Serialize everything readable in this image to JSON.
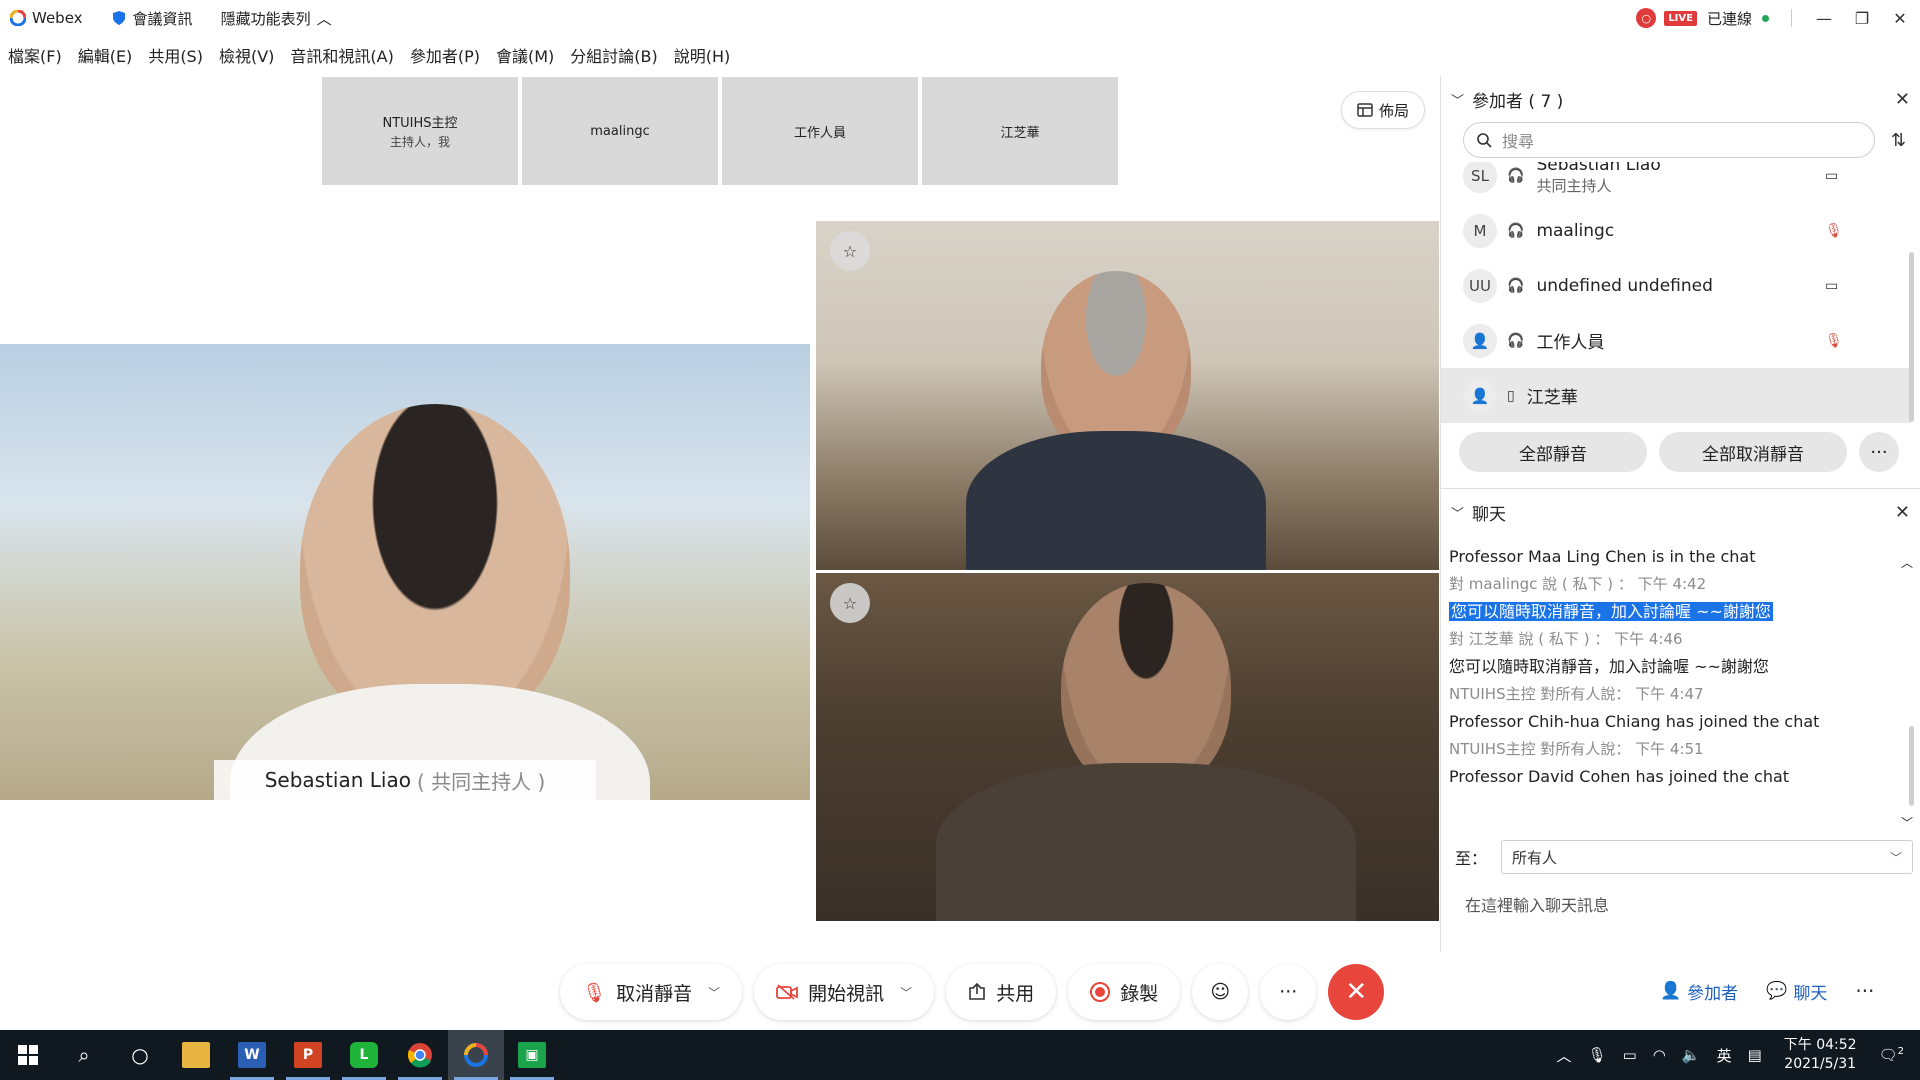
{
  "titlebar": {
    "app_name": "Webex",
    "meeting_info": "會議資訊",
    "hide_menu": "隱藏功能表列",
    "live_badge": "LIVE",
    "connected": "已連線"
  },
  "menu": [
    "檔案(F)",
    "編輯(E)",
    "共用(S)",
    "檢視(V)",
    "音訊和視訊(A)",
    "參加者(P)",
    "會議(M)",
    "分組討論(B)",
    "說明(H)"
  ],
  "menu_keys": [
    "F",
    "E",
    "S",
    "V",
    "A",
    "P",
    "M",
    "B",
    "H"
  ],
  "thumbnails": [
    {
      "name": "NTUIHS主控",
      "sub": "主持人，我"
    },
    {
      "name": "maalingc",
      "sub": ""
    },
    {
      "name": "工作人員",
      "sub": ""
    },
    {
      "name": "江芝華",
      "sub": ""
    }
  ],
  "layout_button": "佈局",
  "main_video": {
    "name": "Sebastian Liao",
    "role": "( 共同主持人 )"
  },
  "controls": {
    "unmute": "取消靜音",
    "start_video": "開始視訊",
    "share": "共用",
    "record": "錄製"
  },
  "bottom_right": {
    "participants": "參加者",
    "chat": "聊天"
  },
  "participants_panel": {
    "title": "參加者 ( 7 )",
    "search_placeholder": "搜尋",
    "rows": [
      {
        "avatar": "SL",
        "name": "Sebastian Liao",
        "role": "共同主持人",
        "icon": "video-icon"
      },
      {
        "avatar": "M",
        "name": "maalingc",
        "role": "",
        "icon": "muted-mic-icon"
      },
      {
        "avatar": "UU",
        "name": "undefined undefined",
        "role": "",
        "icon": "video-icon"
      },
      {
        "avatar": "",
        "name": "工作人員",
        "role": "",
        "icon": "muted-mic-icon"
      },
      {
        "avatar": "",
        "name": "江芝華",
        "role": "",
        "icon": ""
      }
    ],
    "mute_all": "全部靜音",
    "unmute_all": "全部取消靜音"
  },
  "chat_panel": {
    "title": "聊天",
    "messages": [
      {
        "type": "text",
        "text": "Professor Maa Ling Chen is in the chat"
      },
      {
        "type": "meta",
        "text": "對 maalingc 說 ( 私下 ) ：    下午 4:42"
      },
      {
        "type": "highlight",
        "text": "您可以隨時取消靜音，加入討論喔 ~~謝謝您"
      },
      {
        "type": "meta",
        "text": "對 江芝華 說 ( 私下 ) ：    下午 4:46"
      },
      {
        "type": "text",
        "text": "您可以隨時取消靜音，加入討論喔 ~~謝謝您"
      },
      {
        "type": "meta",
        "text": "NTUIHS主控 對所有人說：    下午 4:47"
      },
      {
        "type": "text",
        "text": "Professor Chih-hua Chiang has joined the chat"
      },
      {
        "type": "meta",
        "text": "NTUIHS主控 對所有人說：    下午 4:51"
      },
      {
        "type": "text",
        "text": "Professor David Cohen has joined the chat"
      }
    ],
    "to_label": "至：",
    "to_value": "所有人",
    "input_placeholder": "在這裡輸入聊天訊息"
  },
  "taskbar": {
    "ime": "英",
    "time": "下午 04:52",
    "date": "2021/5/31",
    "notif_count": "2"
  },
  "colors": {
    "accent": "#1b73e8",
    "danger": "#e8453c",
    "taskbar": "#101820"
  }
}
